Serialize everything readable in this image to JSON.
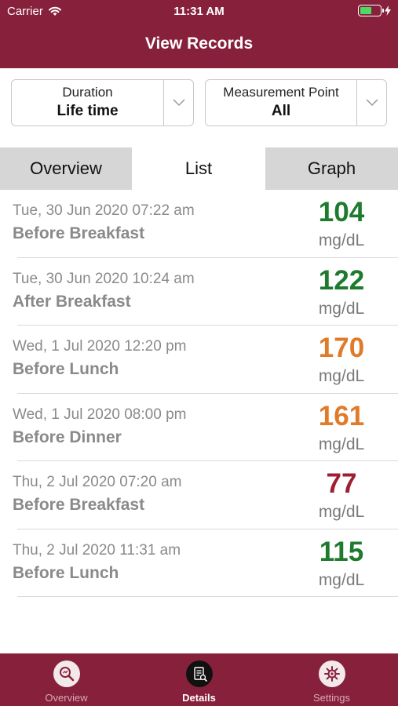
{
  "status_bar": {
    "carrier": "Carrier",
    "time": "11:31 AM"
  },
  "header": {
    "title": "View Records"
  },
  "filters": {
    "duration": {
      "label": "Duration",
      "value": "Life time"
    },
    "measurement_point": {
      "label": "Measurement Point",
      "value": "All"
    }
  },
  "tabs": [
    {
      "label": "Overview"
    },
    {
      "label": "List"
    },
    {
      "label": "Graph"
    }
  ],
  "records": [
    {
      "datetime": "Tue, 30 Jun 2020 07:22 am",
      "meal": "Before Breakfast",
      "value": "104",
      "unit": "mg/dL",
      "color": "#1e7b2e"
    },
    {
      "datetime": "Tue, 30 Jun 2020 10:24 am",
      "meal": "After Breakfast",
      "value": "122",
      "unit": "mg/dL",
      "color": "#1e7b2e"
    },
    {
      "datetime": "Wed, 1 Jul 2020 12:20 pm",
      "meal": "Before Lunch",
      "value": "170",
      "unit": "mg/dL",
      "color": "#e07b2a"
    },
    {
      "datetime": "Wed, 1 Jul 2020 08:00 pm",
      "meal": "Before Dinner",
      "value": "161",
      "unit": "mg/dL",
      "color": "#e07b2a"
    },
    {
      "datetime": "Thu, 2 Jul 2020 07:20 am",
      "meal": "Before Breakfast",
      "value": "77",
      "unit": "mg/dL",
      "color": "#a01e33"
    },
    {
      "datetime": "Thu, 2 Jul 2020 11:31 am",
      "meal": "Before Lunch",
      "value": "115",
      "unit": "mg/dL",
      "color": "#1e7b2e"
    }
  ],
  "bottom_nav": [
    {
      "label": "Overview",
      "icon": "overview-search-icon"
    },
    {
      "label": "Details",
      "icon": "details-document-icon"
    },
    {
      "label": "Settings",
      "icon": "settings-gear-icon"
    }
  ],
  "colors": {
    "brand": "#87213b",
    "normal": "#1e7b2e",
    "high": "#e07b2a",
    "low": "#a01e33"
  }
}
